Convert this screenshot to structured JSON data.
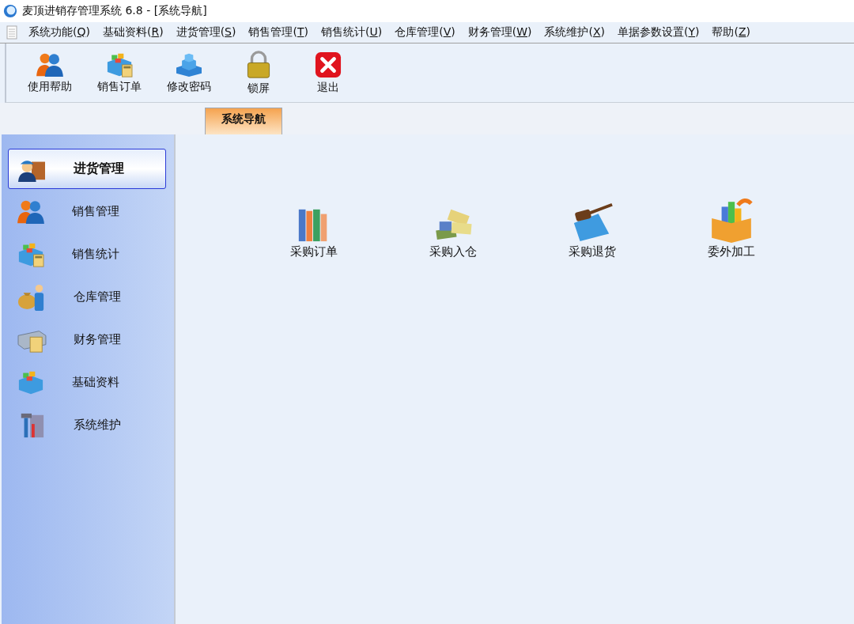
{
  "window": {
    "title": "麦顶进销存管理系统 6.8 - [系统导航]"
  },
  "menu": [
    "系统功能(Q)",
    "基础资料(R)",
    "进货管理(S)",
    "销售管理(T)",
    "销售统计(U)",
    "仓库管理(V)",
    "财务管理(W)",
    "系统维护(X)",
    "单据参数设置(Y)",
    "帮助(Z)"
  ],
  "toolbar": [
    "使用帮助",
    "销售订单",
    "修改密码",
    "锁屏",
    "退出"
  ],
  "tabs": [
    {
      "label": "系统导航",
      "selected": true
    }
  ],
  "sidebar": {
    "items": [
      {
        "label": "进货管理",
        "selected": true
      },
      {
        "label": "销售管理",
        "selected": false
      },
      {
        "label": "销售统计",
        "selected": false
      },
      {
        "label": "仓库管理",
        "selected": false
      },
      {
        "label": "财务管理",
        "selected": false
      },
      {
        "label": "基础资料",
        "selected": false
      },
      {
        "label": "系统维护",
        "selected": false
      }
    ]
  },
  "nav_items": [
    "采购订单",
    "采购入仓",
    "采购退货",
    "委外加工"
  ]
}
